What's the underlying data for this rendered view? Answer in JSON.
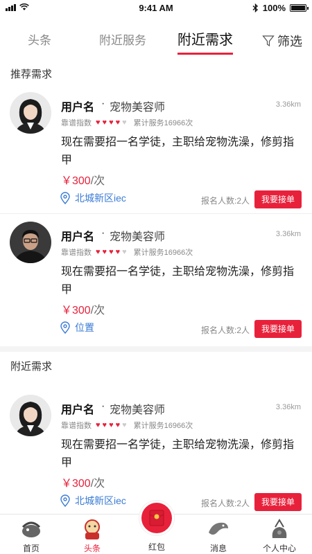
{
  "status": {
    "time": "9:41 AM",
    "battery": "100%",
    "battery_level": 1.0
  },
  "tabs": [
    {
      "label": "头条"
    },
    {
      "label": "附近服务"
    },
    {
      "label": "附近需求"
    }
  ],
  "filter_label": "筛选",
  "sections": {
    "recommended": "推荐需求",
    "nearby": "附近需求"
  },
  "cards": [
    {
      "username": "用户名",
      "separator": "·",
      "role": "宠物美容师",
      "distance": "3.36km",
      "rating_label": "靠谱指数",
      "rating": 4,
      "rating_max": 5,
      "served": "累计服务16966次",
      "description": "现在需要招一名学徒，主职给宠物洗澡，修剪指甲",
      "price": "￥300",
      "price_unit": "/次",
      "location": "北城新区iec",
      "signup": "报名人数:2人",
      "button": "我要接单",
      "avatar": "female-avatar"
    },
    {
      "username": "用户名",
      "separator": "·",
      "role": "宠物美容师",
      "distance": "3.36km",
      "rating_label": "靠谱指数",
      "rating": 4,
      "rating_max": 5,
      "served": "累计服务16966次",
      "description": "现在需要招一名学徒，主职给宠物洗澡，修剪指甲",
      "price": "￥300",
      "price_unit": "/次",
      "location": "位置",
      "signup": "报名人数:2人",
      "button": "我要接单",
      "avatar": "male-avatar"
    },
    {
      "username": "用户名",
      "separator": "·",
      "role": "宠物美容师",
      "distance": "3.36km",
      "rating_label": "靠谱指数",
      "rating": 4,
      "rating_max": 5,
      "served": "累计服务16966次",
      "description": "现在需要招一名学徒，主职给宠物洗澡，修剪指甲",
      "price": "￥300",
      "price_unit": "/次",
      "location": "北城新区iec",
      "signup": "报名人数:2人",
      "button": "我要接单",
      "avatar": "female-avatar"
    }
  ],
  "nav": [
    {
      "label": "首页",
      "icon": "home-icon"
    },
    {
      "label": "头条",
      "icon": "headline-icon"
    },
    {
      "label": "红包",
      "icon": "red-packet-icon"
    },
    {
      "label": "消息",
      "icon": "message-icon"
    },
    {
      "label": "个人中心",
      "icon": "profile-icon"
    }
  ],
  "colors": {
    "accent": "#e8213b",
    "link": "#3a7bd5",
    "heart_off": "#cccccc"
  }
}
